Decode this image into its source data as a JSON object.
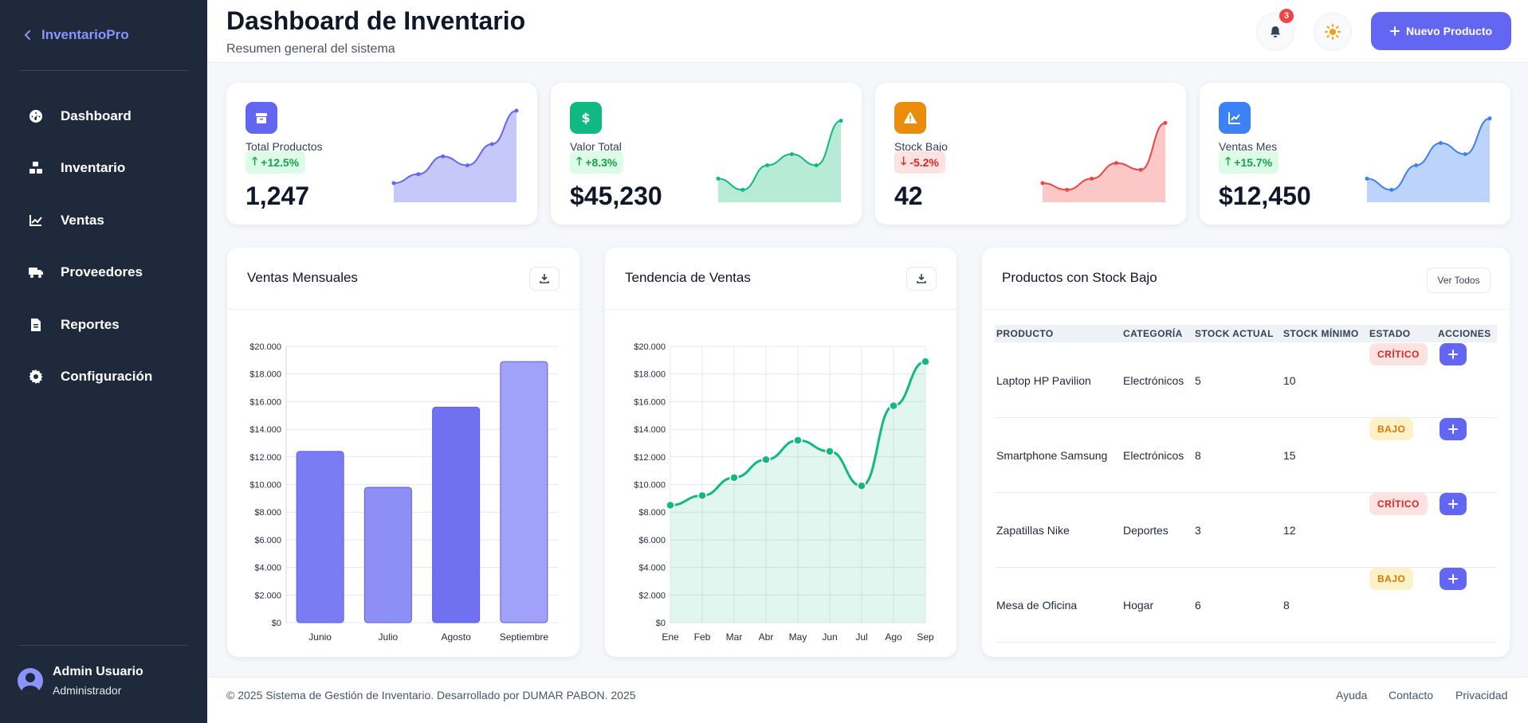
{
  "sidebar": {
    "brand": "InventarioPro",
    "items": [
      {
        "label": "Dashboard",
        "icon": "gauge-icon"
      },
      {
        "label": "Inventario",
        "icon": "boxes-icon"
      },
      {
        "label": "Ventas",
        "icon": "chart-line-icon"
      },
      {
        "label": "Proveedores",
        "icon": "truck-icon"
      },
      {
        "label": "Reportes",
        "icon": "file-icon"
      },
      {
        "label": "Configuración",
        "icon": "gear-icon"
      }
    ],
    "user": {
      "name": "Admin Usuario",
      "role": "Administrador"
    }
  },
  "header": {
    "title": "Dashboard de Inventario",
    "subtitle": "Resumen general del sistema",
    "notification_count": "3",
    "new_button": "Nuevo Producto"
  },
  "stats": [
    {
      "label": "Total Productos",
      "change": "+12.5%",
      "value": "1,247",
      "direction": "up",
      "color": "#6366f1",
      "fill": "#c7c8fa",
      "spark": [
        10,
        18,
        34,
        26,
        45,
        75
      ]
    },
    {
      "label": "Valor Total",
      "change": "+8.3%",
      "value": "$45,230",
      "direction": "up",
      "color": "#10b981",
      "fill": "#b7ebd6",
      "spark": [
        14,
        4,
        26,
        36,
        26,
        66
      ]
    },
    {
      "label": "Stock Bajo",
      "change": "-5.2%",
      "value": "42",
      "direction": "down",
      "color": "#ef4444",
      "fill": "#fbc7c7",
      "spark": [
        10,
        4,
        14,
        28,
        22,
        64
      ]
    },
    {
      "label": "Ventas Mes",
      "change": "+15.7%",
      "value": "$12,450",
      "direction": "up",
      "color": "#3b82f6",
      "fill": "#bcd4fb",
      "spark": [
        14,
        4,
        26,
        46,
        36,
        68
      ]
    }
  ],
  "panels": {
    "bar_title": "Ventas Mensuales",
    "line_title": "Tendencia de Ventas",
    "table_title": "Productos con Stock Bajo",
    "view_all": "Ver Todos"
  },
  "chart_data": [
    {
      "type": "bar",
      "title": "Ventas Mensuales",
      "categories": [
        "Junio",
        "Julio",
        "Agosto",
        "Septiembre"
      ],
      "values": [
        12400,
        9800,
        15600,
        18900
      ],
      "ylim": [
        0,
        20000
      ],
      "yticks": [
        "$0",
        "$2.000",
        "$4.000",
        "$6.000",
        "$8.000",
        "$10.000",
        "$12.000",
        "$14.000",
        "$16.000",
        "$18.000",
        "$20.000"
      ],
      "grid": true
    },
    {
      "type": "area",
      "title": "Tendencia de Ventas",
      "categories": [
        "Ene",
        "Feb",
        "Mar",
        "Abr",
        "May",
        "Jun",
        "Jul",
        "Ago",
        "Sep"
      ],
      "values": [
        8500,
        9200,
        10500,
        11800,
        13200,
        12400,
        9900,
        15700,
        18900
      ],
      "ylim": [
        0,
        20000
      ],
      "yticks": [
        "$0",
        "$2.000",
        "$4.000",
        "$6.000",
        "$8.000",
        "$10.000",
        "$12.000",
        "$14.000",
        "$16.000",
        "$18.000",
        "$20.000"
      ],
      "grid": true
    }
  ],
  "table": {
    "headers": [
      "PRODUCTO",
      "CATEGORÍA",
      "STOCK ACTUAL",
      "STOCK MÍNIMO",
      "ESTADO",
      "ACCIONES"
    ],
    "rows": [
      {
        "product": "Laptop HP Pavilion",
        "category": "Electrónicos",
        "stock": "5",
        "min": "10",
        "status": "CRÍTICO",
        "level": "critical"
      },
      {
        "product": "Smartphone Samsung",
        "category": "Electrónicos",
        "stock": "8",
        "min": "15",
        "status": "BAJO",
        "level": "low"
      },
      {
        "product": "Zapatillas Nike",
        "category": "Deportes",
        "stock": "3",
        "min": "12",
        "status": "CRÍTICO",
        "level": "critical"
      },
      {
        "product": "Mesa de Oficina",
        "category": "Hogar",
        "stock": "6",
        "min": "8",
        "status": "BAJO",
        "level": "low"
      }
    ]
  },
  "footer": {
    "copyright": "© 2025 Sistema de Gestión de Inventario. Desarrollado por DUMAR PABON. 2025",
    "links": [
      "Ayuda",
      "Contacto",
      "Privacidad"
    ]
  },
  "colors": {
    "accent": "#6366f1",
    "sidebar": "#1e293b",
    "critical_bg": "#fde2e2",
    "critical_text": "#dc2626",
    "low_bg": "#fdf1c7",
    "low_text": "#d97706"
  }
}
